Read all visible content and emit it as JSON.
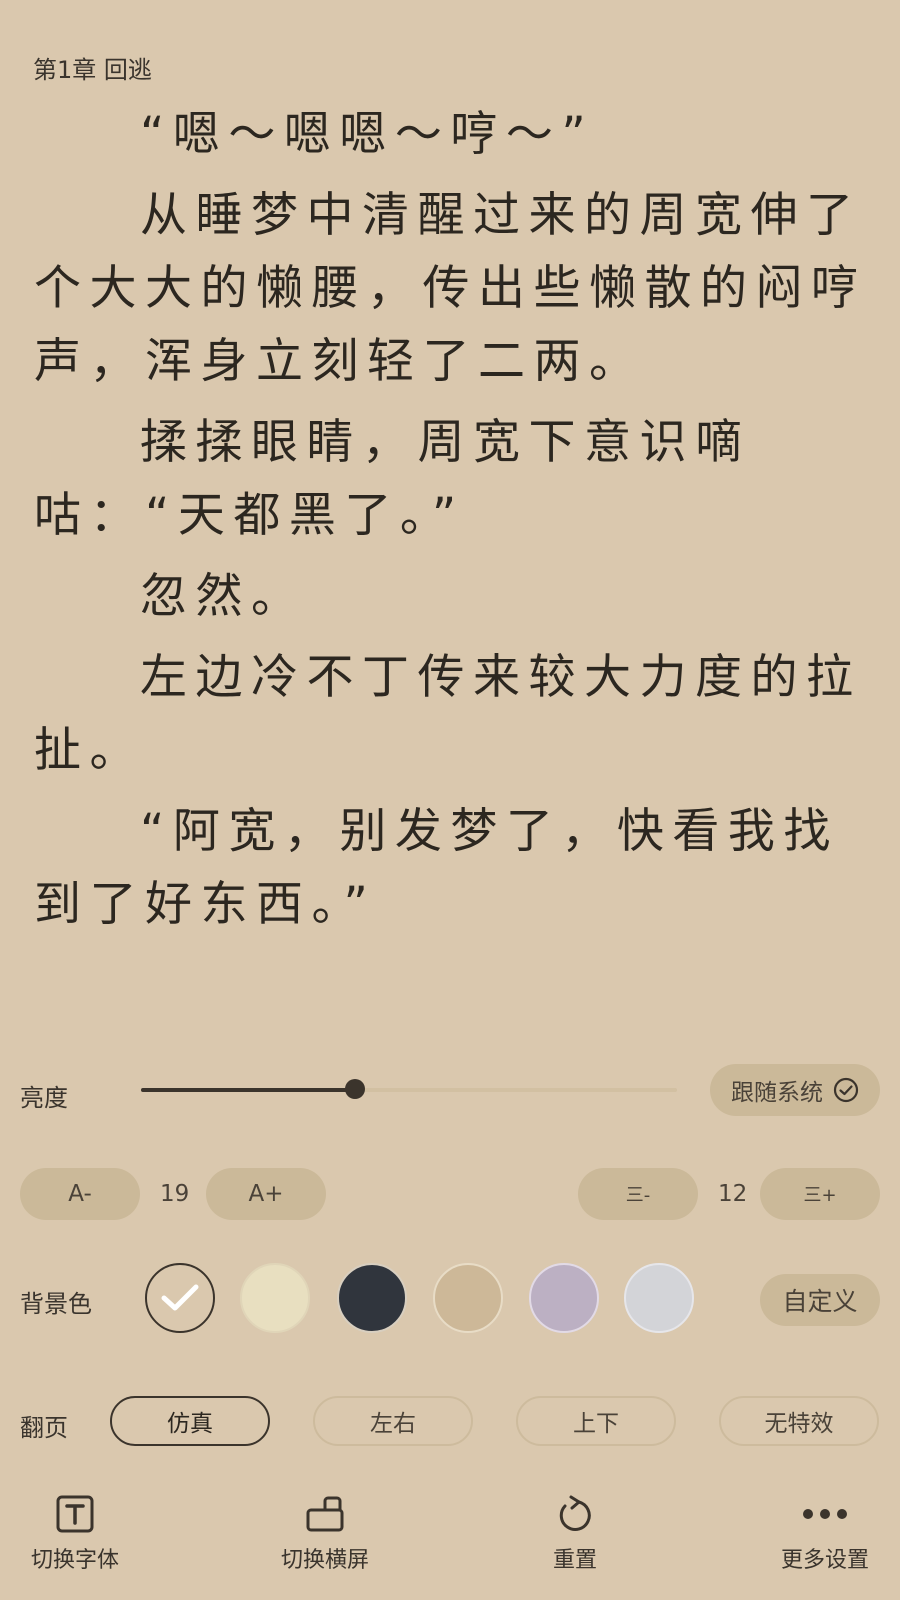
{
  "chapter": {
    "title": "第1章 回逃"
  },
  "paragraphs": [
    "“嗯～嗯嗯～哼～”",
    "从睡梦中清醒过来的周宽伸了个大大的懒腰，传出些懒散的闷哼声，浑身立刻轻了二两。",
    "揉揉眼睛，周宽下意识嘀咕：“天都黑了。”",
    "忽然。",
    "左边冷不丁传来较大力度的拉扯。",
    "“阿宽，别发梦了，快看我找到了好东西。”"
  ],
  "brightness": {
    "label": "亮度",
    "level_percent": 40,
    "follow_system_label": "跟随系统",
    "follow_system_checked": true
  },
  "font_size": {
    "decrease_label": "A-",
    "value": "19",
    "increase_label": "A+"
  },
  "line_spacing": {
    "decrease_label": "三-",
    "value": "12",
    "increase_label": "三+"
  },
  "background": {
    "label": "背景色",
    "custom_label": "自定义",
    "selected_index": 0,
    "colors": [
      "#dac8ae",
      "#e8dfc0",
      "#30353d",
      "#cdb898",
      "#bcb0c3",
      "#d3d4d8"
    ]
  },
  "page_turn": {
    "label": "翻页",
    "options": [
      "仿真",
      "左右",
      "上下",
      "无特效"
    ],
    "selected_index": 0
  },
  "bottom_bar": {
    "font_label": "切换字体",
    "landscape_label": "切换横屏",
    "reset_label": "重置",
    "more_label": "更多设置"
  },
  "colors": {
    "background": "#dac8ae",
    "text": "#2c2720",
    "pill": "#cbb999",
    "accent": "#3b342c"
  }
}
